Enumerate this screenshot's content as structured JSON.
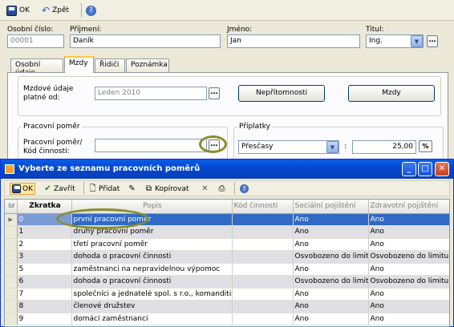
{
  "toolbar": {
    "ok_label": "OK",
    "back_label": "Zpět"
  },
  "header": {
    "personal_number_label": "Osobní číslo:",
    "personal_number_value": "00001",
    "surname_label": "Příjmení:",
    "surname_value": "Daník",
    "firstname_label": "Jméno:",
    "firstname_value": "Jan",
    "title_label": "Titul:",
    "title_value": "Ing."
  },
  "tabs": [
    {
      "label": "Osobní údaje"
    },
    {
      "label": "Mzdy"
    },
    {
      "label": "Řidiči"
    },
    {
      "label": "Poznámka"
    }
  ],
  "mzdy_tab": {
    "valid_from_label_1": "Mzdové údaje",
    "valid_from_label_2": "platné od:",
    "valid_from_value": "Leden 2010",
    "absence_button": "Nepřítomnosti",
    "wages_button": "Mzdy",
    "employment_group_title": "Pracovní poměr",
    "employment_label_1": "Pracovní poměr/",
    "employment_label_2": "Kód činnosti:",
    "employment_value": "",
    "allowances_group_title": "Příplatky",
    "allowance_type": "Přesčasy",
    "allowance_colon": ":",
    "allowance_value": "25,00",
    "percent_label": "%"
  },
  "dialog": {
    "title": "Vyberte ze seznamu pracovních poměrů",
    "toolbar": {
      "ok_label": "OK",
      "close_label": "Zavřít",
      "add_label": "Přidat",
      "copy_label": "Kopírovat"
    },
    "table": {
      "corner_label": "Šíř\nObr",
      "columns": [
        "Zkratka",
        "Popis",
        "Kód činnosti",
        "Sociální pojištění",
        "Zdravotní pojištění"
      ],
      "rows": [
        {
          "code": "0",
          "desc": "první pracovní poměr",
          "activity": "",
          "social": "Ano",
          "health": "Ano"
        },
        {
          "code": "1",
          "desc": "druhý pracovní poměr",
          "activity": "",
          "social": "Ano",
          "health": "Ano"
        },
        {
          "code": "2",
          "desc": "třetí pracovní poměr",
          "activity": "",
          "social": "Ano",
          "health": "Ano"
        },
        {
          "code": "3",
          "desc": "dohoda o pracovní činnosti",
          "activity": "",
          "social": "Osvobozeno do limitu",
          "health": "Osvobozeno do limitu"
        },
        {
          "code": "5",
          "desc": "zaměstnanci na nepravidelnou výpomoc",
          "activity": "",
          "social": "Ano",
          "health": "Ano"
        },
        {
          "code": "6",
          "desc": "dohoda o pracovní činnosti",
          "activity": "",
          "social": "Osvobozeno do limitu",
          "health": "Osvobozeno do limitu"
        },
        {
          "code": "7",
          "desc": "společníci a jednatelé spol. s r.o., komanditisté",
          "activity": "",
          "social": "Ano",
          "health": "Ano"
        },
        {
          "code": "8",
          "desc": "členové družstev",
          "activity": "",
          "social": "Ano",
          "health": "Ano"
        },
        {
          "code": "9",
          "desc": "domácí zaměstnanci",
          "activity": "",
          "social": "Ano",
          "health": "Ano"
        }
      ]
    }
  }
}
